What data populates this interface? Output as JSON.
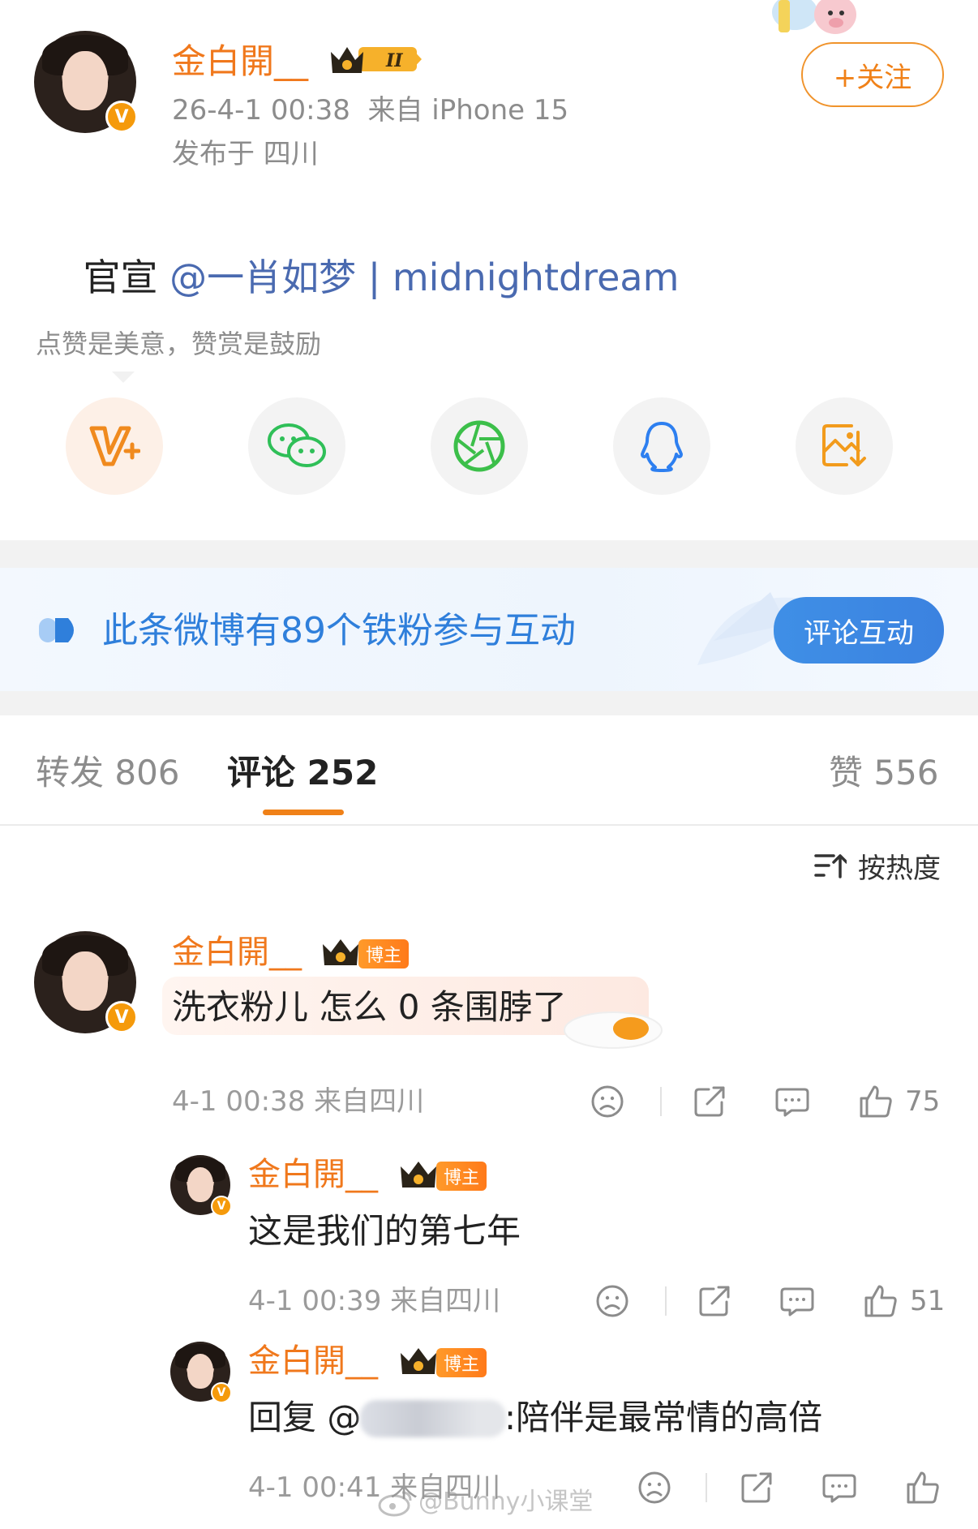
{
  "post": {
    "username": "金白開__",
    "time_source": "26-4-1 00:38  来自 iPhone 15",
    "location": "发布于 四川",
    "follow_label": "+关注",
    "text_prefix": "官宣 ",
    "text_mention": "@一肖如梦 | midnightdream",
    "reward_tip": "点赞是美意，赞赏是鼓励"
  },
  "share_icons": [
    "v-plus-icon",
    "wechat-icon",
    "moments-icon",
    "qq-icon",
    "save-image-icon"
  ],
  "fans_banner": {
    "text": "此条微博有89个铁粉参与互动",
    "button": "评论互动"
  },
  "tabs": {
    "repost": "转发 806",
    "comment": "评论 252",
    "like": "赞 556"
  },
  "sort_label": "按热度",
  "comments": [
    {
      "username": "金白開__",
      "tag": "博主",
      "text": "洗衣粉儿 怎么 0 条围脖了",
      "meta": "4-1 00:38 来自四川",
      "likes": "75"
    }
  ],
  "replies": [
    {
      "username": "金白開__",
      "tag": "博主",
      "text": "这是我们的第七年",
      "meta": "4-1 00:39 来自四川",
      "likes": "51"
    },
    {
      "username": "金白開__",
      "tag": "博主",
      "text_prefix": "回复 @",
      "text_suffix": ":陪伴是最常情的高倍",
      "meta": "4-1 00:41 来自四川",
      "likes": ""
    }
  ],
  "watermark": "@Bunny小课堂",
  "colors": {
    "accent_orange": "#f0781c",
    "link_blue": "#4a6ab0",
    "banner_blue": "#2f7fdb"
  }
}
